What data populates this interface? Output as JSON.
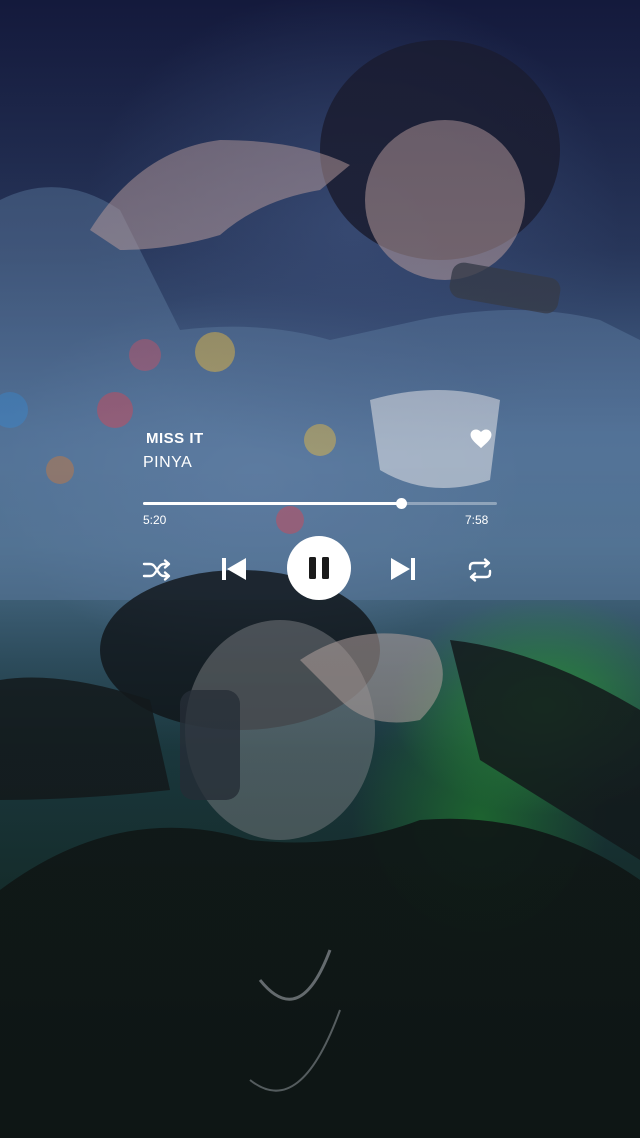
{
  "track": {
    "title": "MISS IT",
    "artist": "PINYA",
    "elapsed": "5:20",
    "duration": "7:58",
    "progress_fraction": 0.73,
    "liked": true
  },
  "controls": {
    "shuffle": "shuffle-icon",
    "previous": "skip-previous-icon",
    "play_state": "pause-icon",
    "next": "skip-next-icon",
    "repeat": "repeat-icon"
  },
  "colors": {
    "accent": "#ffffff"
  }
}
